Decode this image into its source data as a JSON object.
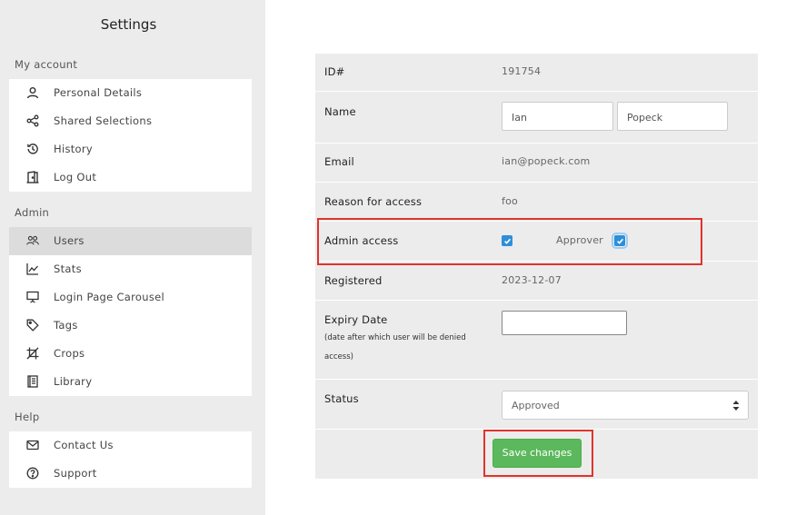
{
  "sidebar": {
    "title": "Settings",
    "sections": [
      {
        "label": "My account",
        "items": [
          {
            "label": "Personal Details",
            "icon": "person-icon"
          },
          {
            "label": "Shared Selections",
            "icon": "share-icon"
          },
          {
            "label": "History",
            "icon": "history-icon"
          },
          {
            "label": "Log Out",
            "icon": "door-icon"
          }
        ]
      },
      {
        "label": "Admin",
        "items": [
          {
            "label": "Users",
            "icon": "users-icon",
            "active": true
          },
          {
            "label": "Stats",
            "icon": "chart-icon"
          },
          {
            "label": "Login Page Carousel",
            "icon": "presentation-icon"
          },
          {
            "label": "Tags",
            "icon": "tag-icon"
          },
          {
            "label": "Crops",
            "icon": "crop-icon"
          },
          {
            "label": "Library",
            "icon": "book-icon"
          }
        ]
      },
      {
        "label": "Help",
        "items": [
          {
            "label": "Contact Us",
            "icon": "envelope-icon"
          },
          {
            "label": "Support",
            "icon": "question-icon"
          }
        ]
      }
    ]
  },
  "form": {
    "id": {
      "label": "ID#",
      "value": "191754"
    },
    "name": {
      "label": "Name",
      "first": "Ian",
      "last": "Popeck"
    },
    "email": {
      "label": "Email",
      "value": "ian@popeck.com"
    },
    "reason": {
      "label": "Reason for access",
      "value": "foo"
    },
    "admin": {
      "label": "Admin access",
      "admin_checked": true,
      "approver_label": "Approver",
      "approver_checked": true
    },
    "registered": {
      "label": "Registered",
      "value": "2023-12-07"
    },
    "expiry": {
      "label": "Expiry Date",
      "sublabel": "(date after which user will be denied access)",
      "value": ""
    },
    "status": {
      "label": "Status",
      "value": "Approved"
    },
    "save_label": "Save changes"
  },
  "colors": {
    "sidebar_bg": "#ececec",
    "active_item_bg": "#dcdcdc",
    "checkbox_blue": "#2e8fd8",
    "save_green": "#5cb85c",
    "highlight_red": "#e0332c"
  }
}
